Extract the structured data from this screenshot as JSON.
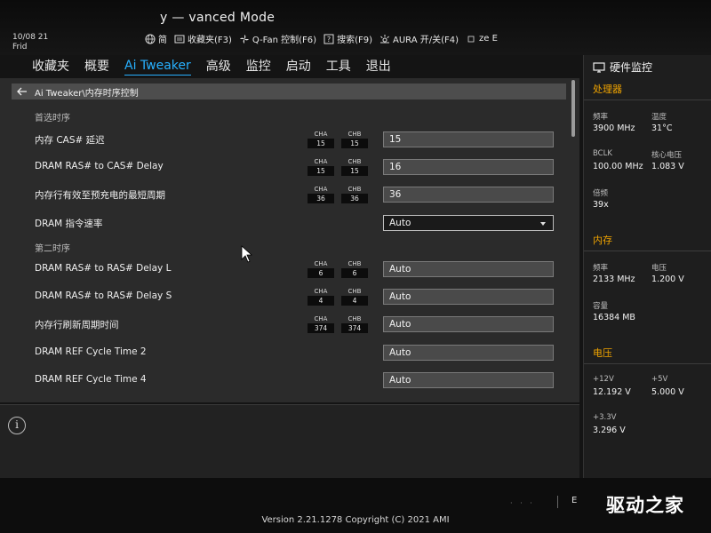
{
  "header": {
    "title": "y — vanced Mode",
    "date": "10/08   21",
    "day": "Frid",
    "toolbar": [
      {
        "id": "language",
        "icon": "globe-icon",
        "label": "简"
      },
      {
        "id": "favorites",
        "icon": "favorites-icon",
        "label": "收藏夹(F3)"
      },
      {
        "id": "qfan",
        "icon": "fan-icon",
        "label": "Q-Fan 控制(F6)"
      },
      {
        "id": "search",
        "icon": "search-help-icon",
        "label": "搜索(F9)"
      },
      {
        "id": "aura",
        "icon": "aura-icon",
        "label": "AURA 开/关(F4)"
      },
      {
        "id": "resize",
        "icon": "resize-icon",
        "label": "ze E"
      }
    ]
  },
  "tabs": [
    {
      "id": "favorites",
      "label": "收藏夹",
      "active": false
    },
    {
      "id": "overview",
      "label": "概要",
      "active": false
    },
    {
      "id": "ai-tweaker",
      "label": "Ai Tweaker",
      "active": true
    },
    {
      "id": "advanced",
      "label": "高级",
      "active": false
    },
    {
      "id": "monitor",
      "label": "监控",
      "active": false
    },
    {
      "id": "boot",
      "label": "启动",
      "active": false
    },
    {
      "id": "tools",
      "label": "工具",
      "active": false
    },
    {
      "id": "exit",
      "label": "退出",
      "active": false
    }
  ],
  "breadcrumb": "Ai Tweaker\\内存时序控制",
  "sections": {
    "primary": "首选时序",
    "secondary": "第二时序"
  },
  "channel_labels": {
    "a": "CHA",
    "b": "CHB"
  },
  "rows": [
    {
      "id": "cas-latency",
      "label": "内存 CAS# 延迟",
      "cha": "15",
      "chb": "15",
      "value": "15",
      "type": "input"
    },
    {
      "id": "ras-to-cas",
      "label": "DRAM RAS# to CAS# Delay",
      "cha": "15",
      "chb": "15",
      "value": "16",
      "type": "input"
    },
    {
      "id": "ras-precharge",
      "label": "内存行有效至预充电的最短周期",
      "cha": "36",
      "chb": "36",
      "value": "36",
      "type": "input"
    },
    {
      "id": "command-rate",
      "label": "DRAM 指令速率",
      "cha": "",
      "chb": "",
      "value": "Auto",
      "type": "select"
    },
    {
      "id": "rrd-l",
      "label": "DRAM RAS# to RAS# Delay L",
      "cha": "6",
      "chb": "6",
      "value": "Auto",
      "type": "input"
    },
    {
      "id": "rrd-s",
      "label": "DRAM RAS# to RAS# Delay S",
      "cha": "4",
      "chb": "4",
      "value": "Auto",
      "type": "input"
    },
    {
      "id": "refresh-cycle",
      "label": "内存行刷新周期时间",
      "cha": "374",
      "chb": "374",
      "value": "Auto",
      "type": "input"
    },
    {
      "id": "ref-cycle-2",
      "label": "DRAM REF Cycle Time 2",
      "cha": "",
      "chb": "",
      "value": "Auto",
      "type": "input"
    },
    {
      "id": "ref-cycle-4",
      "label": "DRAM REF Cycle Time 4",
      "cha": "",
      "chb": "",
      "value": "Auto",
      "type": "input"
    }
  ],
  "info_icon": "info-icon",
  "hw_monitor": {
    "title": "硬件监控",
    "cpu": {
      "heading": "处理器",
      "freq_label": "频率",
      "freq": "3900 MHz",
      "temp_label": "温度",
      "temp": "31°C",
      "bclk_label": "BCLK",
      "bclk": "100.00 MHz",
      "vcore_label": "核心电压",
      "vcore": "1.083 V",
      "ratio_label": "倍频",
      "ratio": "39x"
    },
    "memory": {
      "heading": "内存",
      "freq_label": "频率",
      "freq": "2133 MHz",
      "volt_label": "电压",
      "volt": "1.200 V",
      "cap_label": "容量",
      "cap": "16384 MB"
    },
    "voltage": {
      "heading": "电压",
      "v12_label": "+12V",
      "v12": "12.192 V",
      "v5_label": "+5V",
      "v5": "5.000 V",
      "v33_label": "+3.3V",
      "v33": "3.296 V"
    }
  },
  "footer": {
    "version": "Version 2.21.1278 Copyright (C) 2021 AMI",
    "exit_fragment": "E",
    "watermark": "驱动之家"
  },
  "colors": {
    "accent": "#27b0ff",
    "section_heading": "#f0a400",
    "panel_bg": "#2b2b2b"
  }
}
